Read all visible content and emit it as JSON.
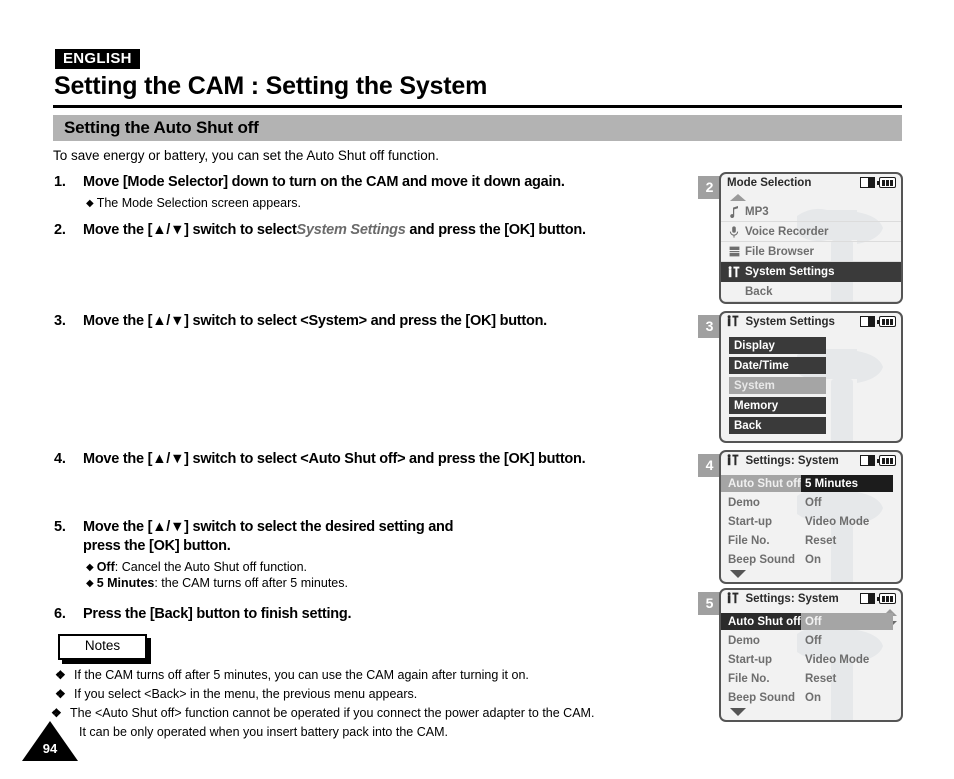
{
  "header": {
    "language_badge": "ENGLISH",
    "title": "Setting the CAM : Setting the System",
    "section_title": "Setting the Auto Shut off",
    "intro": "To save energy or battery, you can set the Auto Shut off function."
  },
  "steps": {
    "s1": {
      "num": "1.",
      "text_a": "Move [Mode Selector] down to turn on the CAM and move it down again.",
      "sub": "The Mode Selection screen appears."
    },
    "s2": {
      "num": "2.",
      "text_a": "Move the [▲/▼] switch to select ",
      "italic": "System Settings",
      "text_b": " and press the [OK] button."
    },
    "s3": {
      "num": "3.",
      "text_a": "Move the [▲/▼] switch to select <System> and press the [OK] button."
    },
    "s4": {
      "num": "4.",
      "text_a": "Move the [▲/▼] switch to select <Auto Shut off> and press the [OK] button."
    },
    "s5": {
      "num": "5.",
      "line1": "Move the [▲/▼] switch to select the desired setting and",
      "line2": "press the [OK] button.",
      "sub1_bold": "Off",
      "sub1_rest": ": Cancel the Auto Shut off function.",
      "sub2_bold": "5 Minutes",
      "sub2_rest": ": the CAM turns off after 5 minutes."
    },
    "s6": {
      "num": "6.",
      "text_a": "Press the [Back] button to finish setting."
    }
  },
  "notes": {
    "label": "Notes",
    "bullet": "❖",
    "items": [
      "If the CAM turns off after 5 minutes, you can use the CAM again after turning it on.",
      "If you select <Back> in the menu, the previous menu appears.",
      "The <Auto Shut off> function cannot be operated if you connect the power adapter to the CAM.",
      "It can be only operated when you insert battery pack into the CAM."
    ]
  },
  "page_number": "94",
  "screens": [
    {
      "badge": "2",
      "title": "Mode Selection",
      "icons": {
        "memory": "memory-card-icon",
        "battery": "battery-icon"
      },
      "items": [
        {
          "icon": "music-note-icon",
          "label": "MP3",
          "selected": false
        },
        {
          "icon": "microphone-icon",
          "label": "Voice Recorder",
          "selected": false
        },
        {
          "icon": "file-browser-icon",
          "label": "File Browser",
          "selected": false
        },
        {
          "icon": "tools-icon",
          "label": "System Settings",
          "selected": true
        },
        {
          "icon": "",
          "label": "Back",
          "selected": false
        }
      ]
    },
    {
      "badge": "3",
      "title": "System Settings",
      "title_icon": "tools-icon",
      "items": [
        {
          "label": "Display",
          "selected": false
        },
        {
          "label": "Date/Time",
          "selected": false
        },
        {
          "label": "System",
          "selected": true
        },
        {
          "label": "Memory",
          "selected": false
        },
        {
          "label": "Back",
          "selected": false
        }
      ]
    },
    {
      "badge": "4",
      "title": "Settings: System",
      "title_icon": "tools-icon",
      "rows": [
        {
          "key": "Auto Shut off",
          "value": "5 Minutes",
          "key_style": "gray",
          "value_style": "dark"
        },
        {
          "key": "Demo",
          "value": "Off",
          "key_style": "",
          "value_style": ""
        },
        {
          "key": "Start-up",
          "value": "Video Mode",
          "key_style": "",
          "value_style": ""
        },
        {
          "key": "File No.",
          "value": "Reset",
          "key_style": "",
          "value_style": ""
        },
        {
          "key": "Beep Sound",
          "value": "On",
          "key_style": "",
          "value_style": ""
        }
      ]
    },
    {
      "badge": "5",
      "title": "Settings: System",
      "title_icon": "tools-icon",
      "rows": [
        {
          "key": "Auto Shut off",
          "value": "Off",
          "key_style": "dark",
          "value_style": "gray"
        },
        {
          "key": "Demo",
          "value": "Off",
          "key_style": "",
          "value_style": ""
        },
        {
          "key": "Start-up",
          "value": "Video Mode",
          "key_style": "",
          "value_style": ""
        },
        {
          "key": "File No.",
          "value": "Reset",
          "key_style": "",
          "value_style": ""
        },
        {
          "key": "Beep Sound",
          "value": "On",
          "key_style": "",
          "value_style": ""
        }
      ]
    }
  ],
  "colors": {
    "section_bar": "#b3b3b3",
    "badge_gray": "#a0a0a0",
    "lcd_bg": "#f2f2f2",
    "selected_dark": "#3a3a3a",
    "selected_gray": "#a5a5a5"
  }
}
